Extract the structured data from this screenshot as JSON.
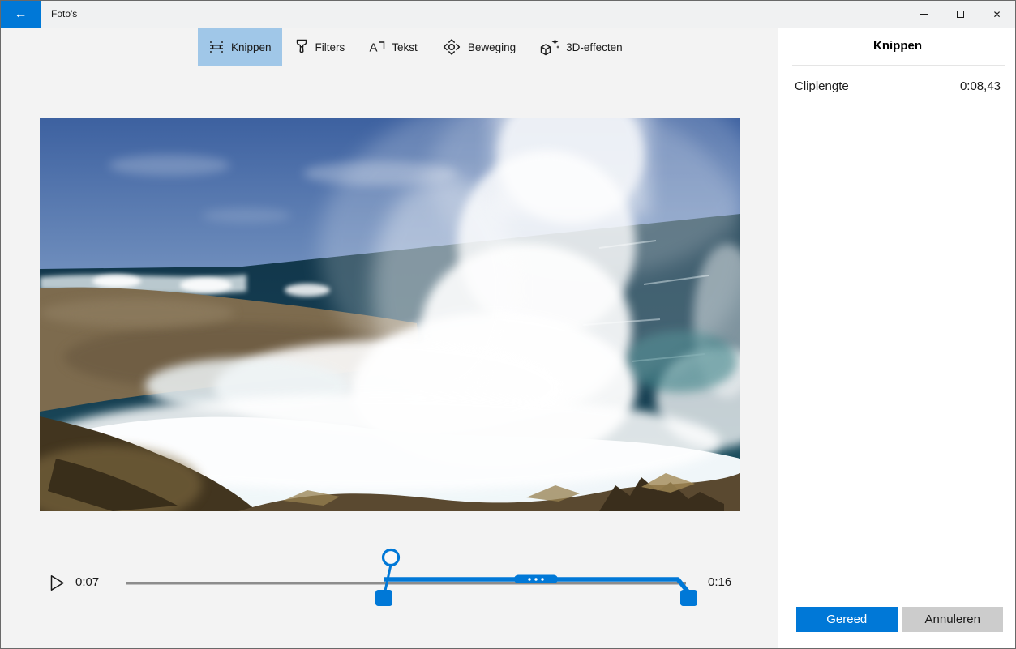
{
  "titlebar": {
    "app_title": "Foto's"
  },
  "icons": {
    "back": "←",
    "close": "✕"
  },
  "toolbar": {
    "items": [
      {
        "label": "Knippen",
        "icon": "trim-icon",
        "selected": true
      },
      {
        "label": "Filters",
        "icon": "filters-icon",
        "selected": false
      },
      {
        "label": "Tekst",
        "icon": "text-icon",
        "icon_glyph": "A",
        "selected": false
      },
      {
        "label": "Beweging",
        "icon": "motion-icon",
        "selected": false
      },
      {
        "label": "3D-effecten",
        "icon": "3d-effects-icon",
        "selected": false
      }
    ]
  },
  "timeline": {
    "current_time": "0:07",
    "end_time": "0:16"
  },
  "panel": {
    "title": "Knippen",
    "rows": [
      {
        "label": "Cliplengte",
        "value": "0:08,43"
      }
    ],
    "done_label": "Gereed",
    "cancel_label": "Annuleren"
  },
  "colors": {
    "accent": "#0078d7",
    "selected_tab": "#a0c7e8",
    "cancel_button_bg": "#cccccc",
    "track_gray": "#8c8c8c",
    "titlebar_bg": "#f0f1f2",
    "panel_bg": "#ffffff"
  }
}
